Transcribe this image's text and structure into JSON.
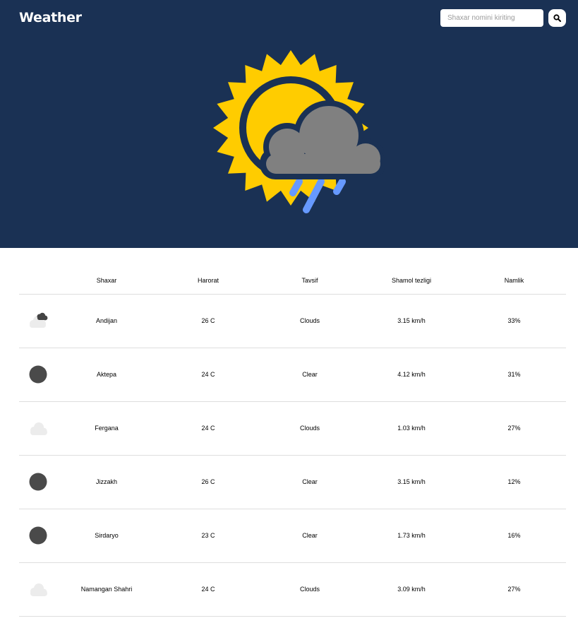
{
  "app": {
    "title": "Weather"
  },
  "search": {
    "placeholder": "Shaxar nomini kiriting",
    "button_icon": "search-icon"
  },
  "hero": {
    "icon": "sun-cloud-rain-icon",
    "colors": {
      "sun": "#ffcc00",
      "cloud": "#808080",
      "rain": "#6699ff",
      "background": "#1a3154"
    }
  },
  "table": {
    "headers": [
      "",
      "Shaxar",
      "Harorat",
      "Tavsif",
      "Shamol tezligi",
      "Namlik"
    ],
    "rows": [
      {
        "icon": "broken-clouds-icon",
        "city": "Andijan",
        "temp": "26 C",
        "desc": "Clouds",
        "wind": "3.15 km/h",
        "humidity": "33%"
      },
      {
        "icon": "clear-moon-icon",
        "city": "Aktepa",
        "temp": "24 C",
        "desc": "Clear",
        "wind": "4.12 km/h",
        "humidity": "31%"
      },
      {
        "icon": "cloud-icon",
        "city": "Fergana",
        "temp": "24 C",
        "desc": "Clouds",
        "wind": "1.03 km/h",
        "humidity": "27%"
      },
      {
        "icon": "clear-moon-icon",
        "city": "Jizzakh",
        "temp": "26 C",
        "desc": "Clear",
        "wind": "3.15 km/h",
        "humidity": "12%"
      },
      {
        "icon": "clear-moon-icon",
        "city": "Sirdaryo",
        "temp": "23 C",
        "desc": "Clear",
        "wind": "1.73 km/h",
        "humidity": "16%"
      },
      {
        "icon": "cloud-icon",
        "city": "Namangan Shahri",
        "temp": "24 C",
        "desc": "Clouds",
        "wind": "3.09 km/h",
        "humidity": "27%"
      }
    ]
  }
}
